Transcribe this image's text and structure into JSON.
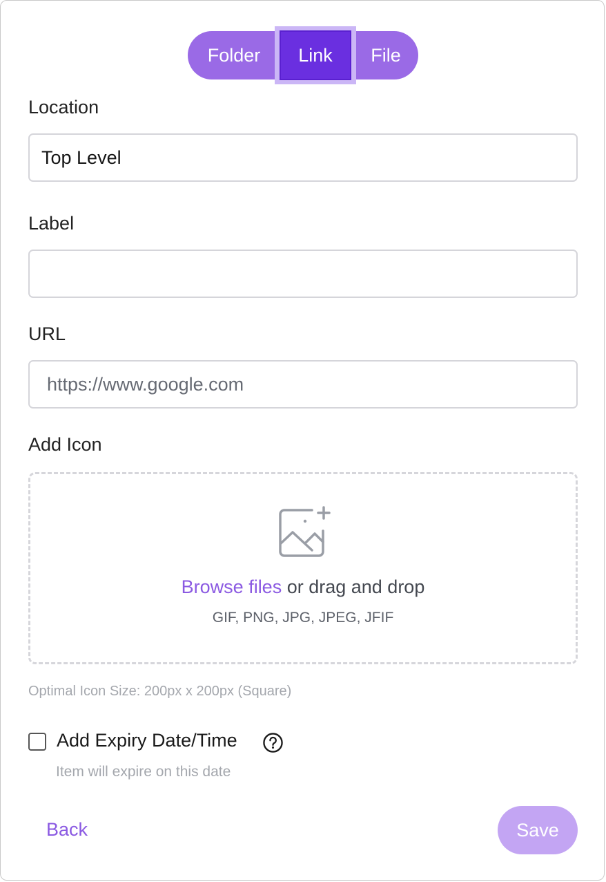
{
  "tabs": {
    "folder": "Folder",
    "link": "Link",
    "file": "File",
    "active": "Link"
  },
  "location": {
    "label": "Location",
    "value": "Top Level"
  },
  "label_field": {
    "label": "Label",
    "value": ""
  },
  "url": {
    "label": "URL",
    "placeholder": "https://www.google.com"
  },
  "icon_upload": {
    "label": "Add Icon",
    "icon": "image-add-icon",
    "browse_text": "Browse files",
    "drag_text": " or drag and drop",
    "formats": "GIF, PNG, JPG, JPEG, JFIF",
    "hint": "Optimal Icon Size: 200px x 200px (Square)"
  },
  "expiry": {
    "label": "Add Expiry Date/Time",
    "checked": false,
    "help_icon": "question-circle-icon",
    "description": "Item will expire on this date"
  },
  "footer": {
    "back_label": "Back",
    "save_label": "Save"
  },
  "colors": {
    "accent": "#8b5ae2",
    "tabs_bg": "#9a6ae6",
    "tab_active": "#6a2fe0",
    "save_disabled": "#c3a5f3"
  }
}
